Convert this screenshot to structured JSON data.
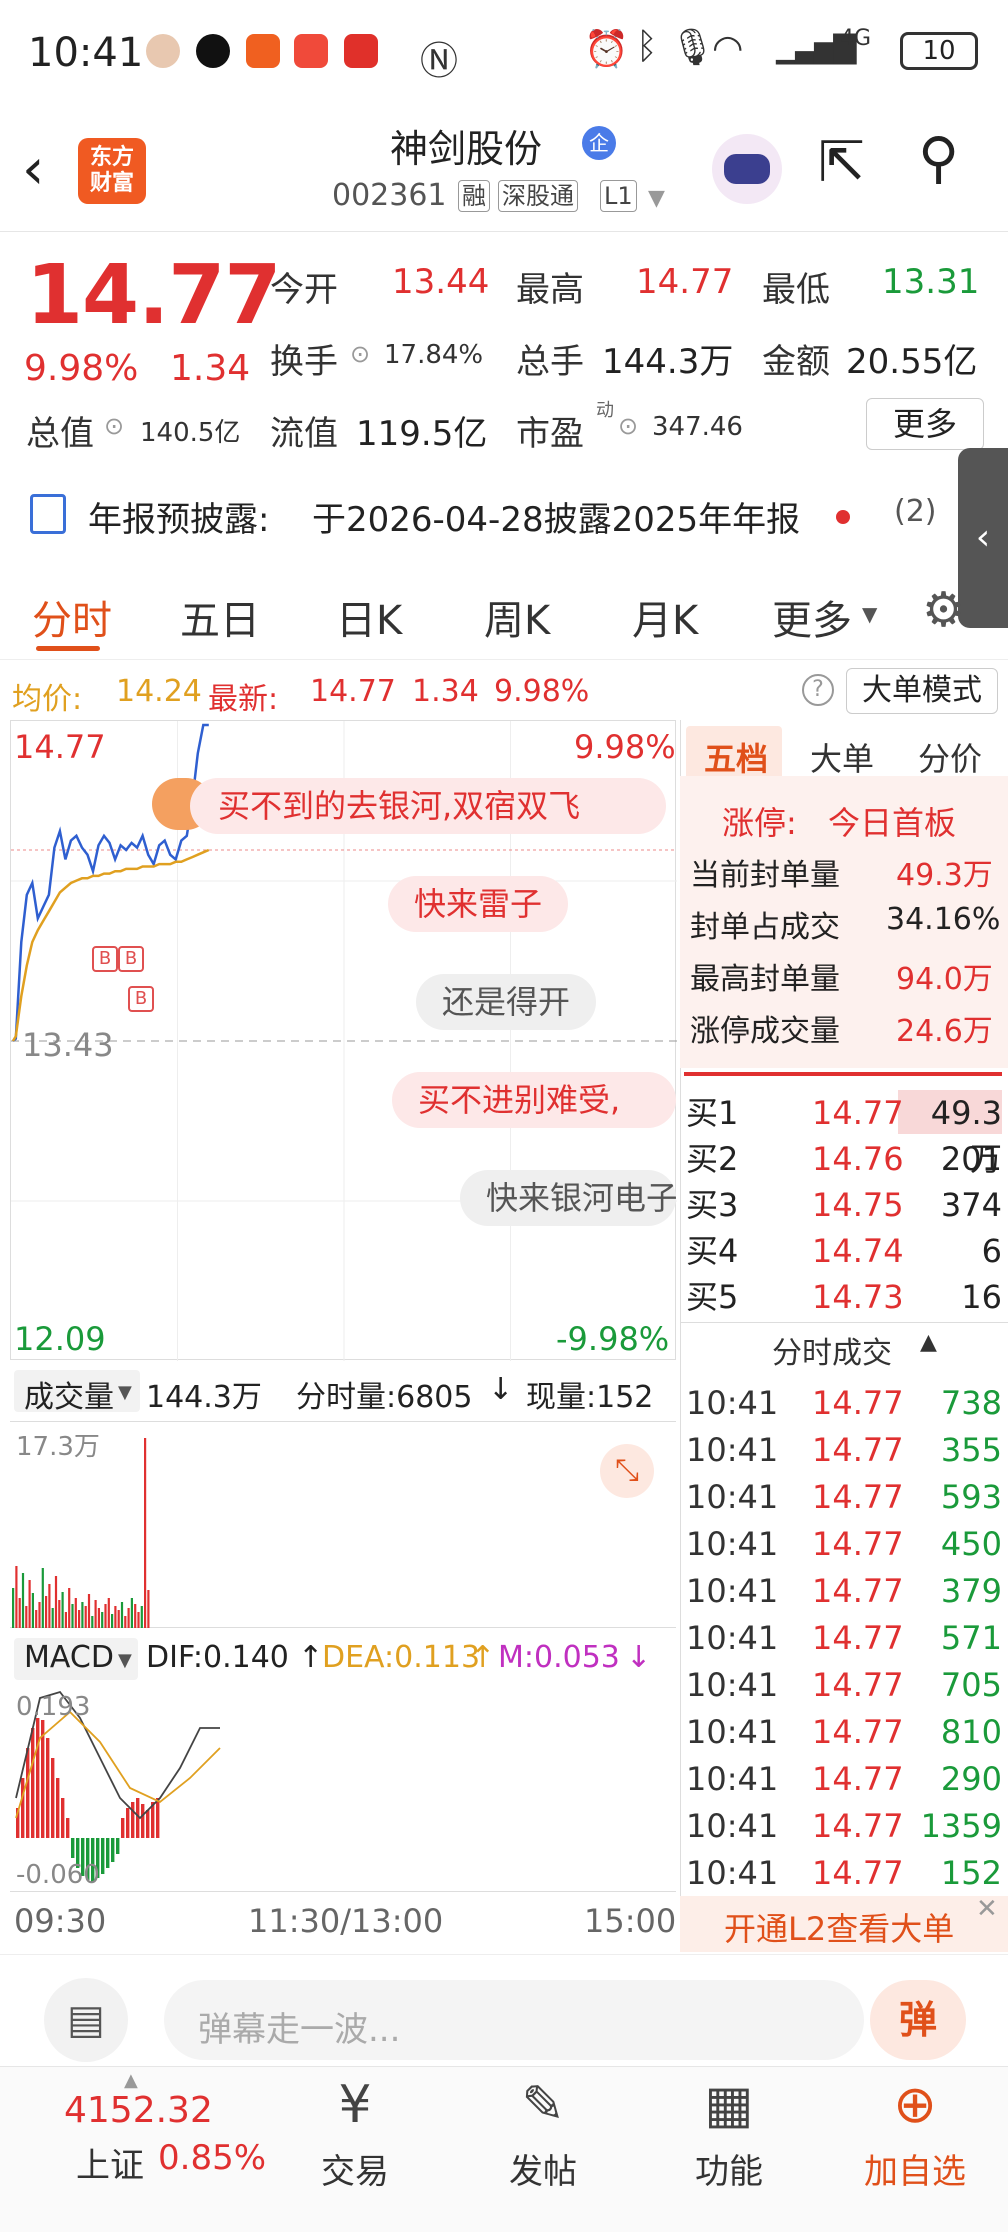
{
  "status": {
    "time": "10:41",
    "battery": "10",
    "network": "4G"
  },
  "header": {
    "back_icon": "back-arrow-icon",
    "logo_text": "东方财富",
    "stock_name": "神剑股份",
    "badge": "企",
    "code": "002361",
    "tags": [
      "融",
      "深股通",
      "L1"
    ]
  },
  "quote": {
    "price": "14.77",
    "change_pct": "9.98%",
    "change": "1.34",
    "open_label": "今开",
    "open": "13.44",
    "high_label": "最高",
    "high": "14.77",
    "low_label": "最低",
    "low": "13.31",
    "turnover_label": "换手",
    "turnover": "17.84%",
    "volume_label": "总手",
    "volume": "144.3万",
    "amount_label": "金额",
    "amount": "20.55亿",
    "mktcap_label": "总值",
    "mktcap": "140.5亿",
    "float_label": "流值",
    "float": "119.5亿",
    "pe_label": "市盈",
    "pe_sup": "动",
    "pe": "347.46",
    "more": "更多"
  },
  "notice": {
    "label": "年报预披露:",
    "text": "于2026-04-28披露2025年年报",
    "count": "(2)"
  },
  "tabs": [
    "分时",
    "五日",
    "日K",
    "周K",
    "月K",
    "更多"
  ],
  "info_bar": {
    "avg_label": "均价:",
    "avg": "14.24",
    "latest_label": "最新:",
    "latest": "14.77",
    "change": "1.34",
    "pct": "9.98%",
    "big_order_mode": "大单模式"
  },
  "chart": {
    "top_price": "14.77",
    "top_pct": "9.98%",
    "mid_price": "13.43",
    "bottom_price": "12.09",
    "bottom_pct": "-9.98%",
    "vol_label": "成交量",
    "vol_total": "144.3万",
    "minute_vol": "分时量:6805",
    "now_vol": "现量:152",
    "vol_max": "17.3万",
    "macd_label": "MACD",
    "dif": "DIF:0.140",
    "dea": "DEA:0.113",
    "m": "M:0.053",
    "macd_top": "0.193",
    "macd_bottom": "-0.060",
    "time_start": "09:30",
    "time_mid": "11:30/13:00",
    "time_end": "15:00",
    "markers": [
      "B",
      "B",
      "B"
    ]
  },
  "chart_data": {
    "type": "line",
    "title": "",
    "series": [
      {
        "x": [
          "09:30",
          "09:31",
          "09:33",
          "09:35",
          "09:37",
          "09:39",
          "09:41",
          "09:43",
          "09:45",
          "09:47",
          "09:49",
          "09:51",
          "09:53",
          "09:55",
          "09:57",
          "09:59",
          "10:01",
          "10:03",
          "10:05",
          "10:07",
          "10:09",
          "10:11",
          "10:13",
          "10:15",
          "10:17",
          "10:19",
          "10:21",
          "10:23",
          "10:25",
          "10:27",
          "10:29",
          "10:31",
          "10:33",
          "10:35",
          "10:37",
          "10:39",
          "10:41"
        ],
        "values": [
          13.43,
          13.44,
          13.85,
          14.05,
          14.1,
          13.95,
          14.0,
          14.05,
          14.25,
          14.32,
          14.2,
          14.28,
          14.3,
          14.25,
          14.22,
          14.15,
          14.26,
          14.3,
          14.27,
          14.2,
          14.26,
          14.24,
          14.27,
          14.25,
          14.3,
          14.22,
          14.18,
          14.26,
          14.28,
          14.22,
          14.2,
          14.28,
          14.3,
          14.45,
          14.65,
          14.77,
          14.77
        ]
      },
      {
        "x": [
          "09:30",
          "09:31",
          "09:33",
          "09:35",
          "09:37",
          "09:39",
          "09:41",
          "09:43",
          "09:45",
          "09:47",
          "09:49",
          "09:51",
          "09:53",
          "09:55",
          "09:57",
          "09:59",
          "10:01",
          "10:03",
          "10:05",
          "10:07",
          "10:09",
          "10:11",
          "10:13",
          "10:15",
          "10:17",
          "10:19",
          "10:21",
          "10:23",
          "10:25",
          "10:27",
          "10:29",
          "10:31",
          "10:33",
          "10:35",
          "10:37",
          "10:39",
          "10:41"
        ],
        "values": [
          13.43,
          13.45,
          13.62,
          13.75,
          13.85,
          13.9,
          13.94,
          13.98,
          14.02,
          14.06,
          14.08,
          14.1,
          14.11,
          14.12,
          14.12,
          14.13,
          14.13,
          14.14,
          14.14,
          14.15,
          14.15,
          14.16,
          14.16,
          14.16,
          14.17,
          14.17,
          14.17,
          14.18,
          14.18,
          14.18,
          14.19,
          14.19,
          14.2,
          14.21,
          14.22,
          14.23,
          14.24
        ]
      }
    ],
    "ylim": [
      12.09,
      14.77
    ],
    "colors": [
      "#2f5fd0",
      "#e0a020"
    ]
  },
  "danmaku": [
    {
      "text": "买不到的去银河,双宿双飞",
      "style": "pink"
    },
    {
      "text": "快来雷子",
      "style": "pink"
    },
    {
      "text": "还是得开",
      "style": "gray"
    },
    {
      "text": "买不进别难受,",
      "style": "pink"
    },
    {
      "text": "快来银河电子",
      "style": "gray"
    }
  ],
  "panel": {
    "tabs": [
      "五档",
      "大单",
      "分价"
    ],
    "limit_label": "涨停:",
    "limit_text": "今日首板",
    "stats": [
      {
        "label": "当前封单量",
        "value": "49.3万"
      },
      {
        "label": "封单占成交",
        "value": "34.16%"
      },
      {
        "label": "最高封单量",
        "value": "94.0万"
      },
      {
        "label": "涨停成交量",
        "value": "24.6万"
      }
    ],
    "bids": [
      {
        "label": "买1",
        "price": "14.77",
        "vol": "49.3万"
      },
      {
        "label": "买2",
        "price": "14.76",
        "vol": "201"
      },
      {
        "label": "买3",
        "price": "14.75",
        "vol": "374"
      },
      {
        "label": "买4",
        "price": "14.74",
        "vol": "6"
      },
      {
        "label": "买5",
        "price": "14.73",
        "vol": "16"
      }
    ],
    "ticks_title": "分时成交",
    "ticks": [
      {
        "time": "10:41",
        "price": "14.77",
        "vol": "738"
      },
      {
        "time": "10:41",
        "price": "14.77",
        "vol": "355"
      },
      {
        "time": "10:41",
        "price": "14.77",
        "vol": "593"
      },
      {
        "time": "10:41",
        "price": "14.77",
        "vol": "450"
      },
      {
        "time": "10:41",
        "price": "14.77",
        "vol": "379"
      },
      {
        "time": "10:41",
        "price": "14.77",
        "vol": "571"
      },
      {
        "time": "10:41",
        "price": "14.77",
        "vol": "705"
      },
      {
        "time": "10:41",
        "price": "14.77",
        "vol": "810"
      },
      {
        "time": "10:41",
        "price": "14.77",
        "vol": "290"
      },
      {
        "time": "10:41",
        "price": "14.77",
        "vol": "1359"
      },
      {
        "time": "10:41",
        "price": "14.77",
        "vol": "152"
      }
    ],
    "l2_banner": "开通L2查看大单"
  },
  "comment": {
    "placeholder": "弹幕走一波...",
    "danmu_btn": "弹"
  },
  "bottom": {
    "index_value": "4152.32",
    "index_name": "上证",
    "index_pct": "0.85%",
    "items": [
      {
        "label": "交易",
        "icon": "yen-cycle-icon"
      },
      {
        "label": "发帖",
        "icon": "edit-icon"
      },
      {
        "label": "功能",
        "icon": "grid-icon"
      },
      {
        "label": "加自选",
        "icon": "plus-circle-icon"
      }
    ]
  }
}
